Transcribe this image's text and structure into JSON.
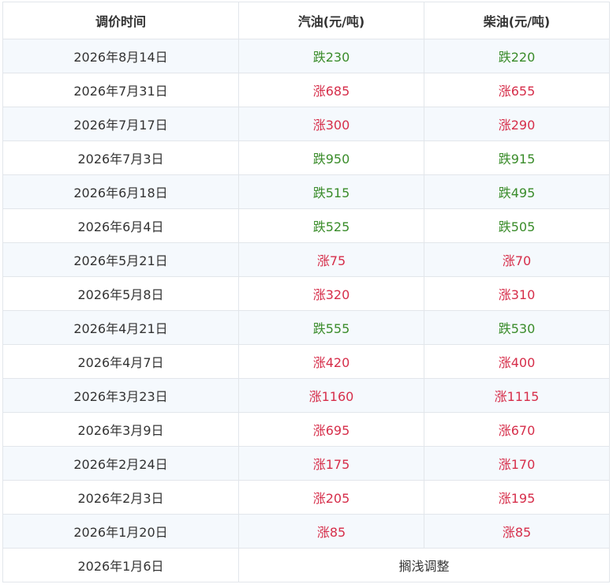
{
  "table": {
    "headers": [
      "调价时间",
      "汽油(元/吨)",
      "柴油(元/吨)"
    ],
    "rows": [
      {
        "date": "2026年8月14日",
        "gasoline": "跌230",
        "diesel": "跌220",
        "gasoline_dir": "down",
        "diesel_dir": "down"
      },
      {
        "date": "2026年7月31日",
        "gasoline": "涨685",
        "diesel": "涨655",
        "gasoline_dir": "up",
        "diesel_dir": "up"
      },
      {
        "date": "2026年7月17日",
        "gasoline": "涨300",
        "diesel": "涨290",
        "gasoline_dir": "up",
        "diesel_dir": "up"
      },
      {
        "date": "2026年7月3日",
        "gasoline": "跌950",
        "diesel": "跌915",
        "gasoline_dir": "down",
        "diesel_dir": "down"
      },
      {
        "date": "2026年6月18日",
        "gasoline": "跌515",
        "diesel": "跌495",
        "gasoline_dir": "down",
        "diesel_dir": "down"
      },
      {
        "date": "2026年6月4日",
        "gasoline": "跌525",
        "diesel": "跌505",
        "gasoline_dir": "down",
        "diesel_dir": "down"
      },
      {
        "date": "2026年5月21日",
        "gasoline": "涨75",
        "diesel": "涨70",
        "gasoline_dir": "up",
        "diesel_dir": "up"
      },
      {
        "date": "2026年5月8日",
        "gasoline": "涨320",
        "diesel": "涨310",
        "gasoline_dir": "up",
        "diesel_dir": "up"
      },
      {
        "date": "2026年4月21日",
        "gasoline": "跌555",
        "diesel": "跌530",
        "gasoline_dir": "down",
        "diesel_dir": "down"
      },
      {
        "date": "2026年4月7日",
        "gasoline": "涨420",
        "diesel": "涨400",
        "gasoline_dir": "up",
        "diesel_dir": "up"
      },
      {
        "date": "2026年3月23日",
        "gasoline": "涨1160",
        "diesel": "涨1115",
        "gasoline_dir": "up",
        "diesel_dir": "up"
      },
      {
        "date": "2026年3月9日",
        "gasoline": "涨695",
        "diesel": "涨670",
        "gasoline_dir": "up",
        "diesel_dir": "up"
      },
      {
        "date": "2026年2月24日",
        "gasoline": "涨175",
        "diesel": "涨170",
        "gasoline_dir": "up",
        "diesel_dir": "up"
      },
      {
        "date": "2026年2月3日",
        "gasoline": "涨205",
        "diesel": "涨195",
        "gasoline_dir": "up",
        "diesel_dir": "up"
      },
      {
        "date": "2026年1月20日",
        "gasoline": "涨85",
        "diesel": "涨85",
        "gasoline_dir": "up",
        "diesel_dir": "up"
      }
    ],
    "last_row": {
      "date": "2026年1月6日",
      "note": "搁浅调整"
    }
  },
  "colors": {
    "down": "#3a8c2a",
    "up": "#d62e4a",
    "border": "#e2e6eb",
    "stripe": "#f5f9fd"
  }
}
